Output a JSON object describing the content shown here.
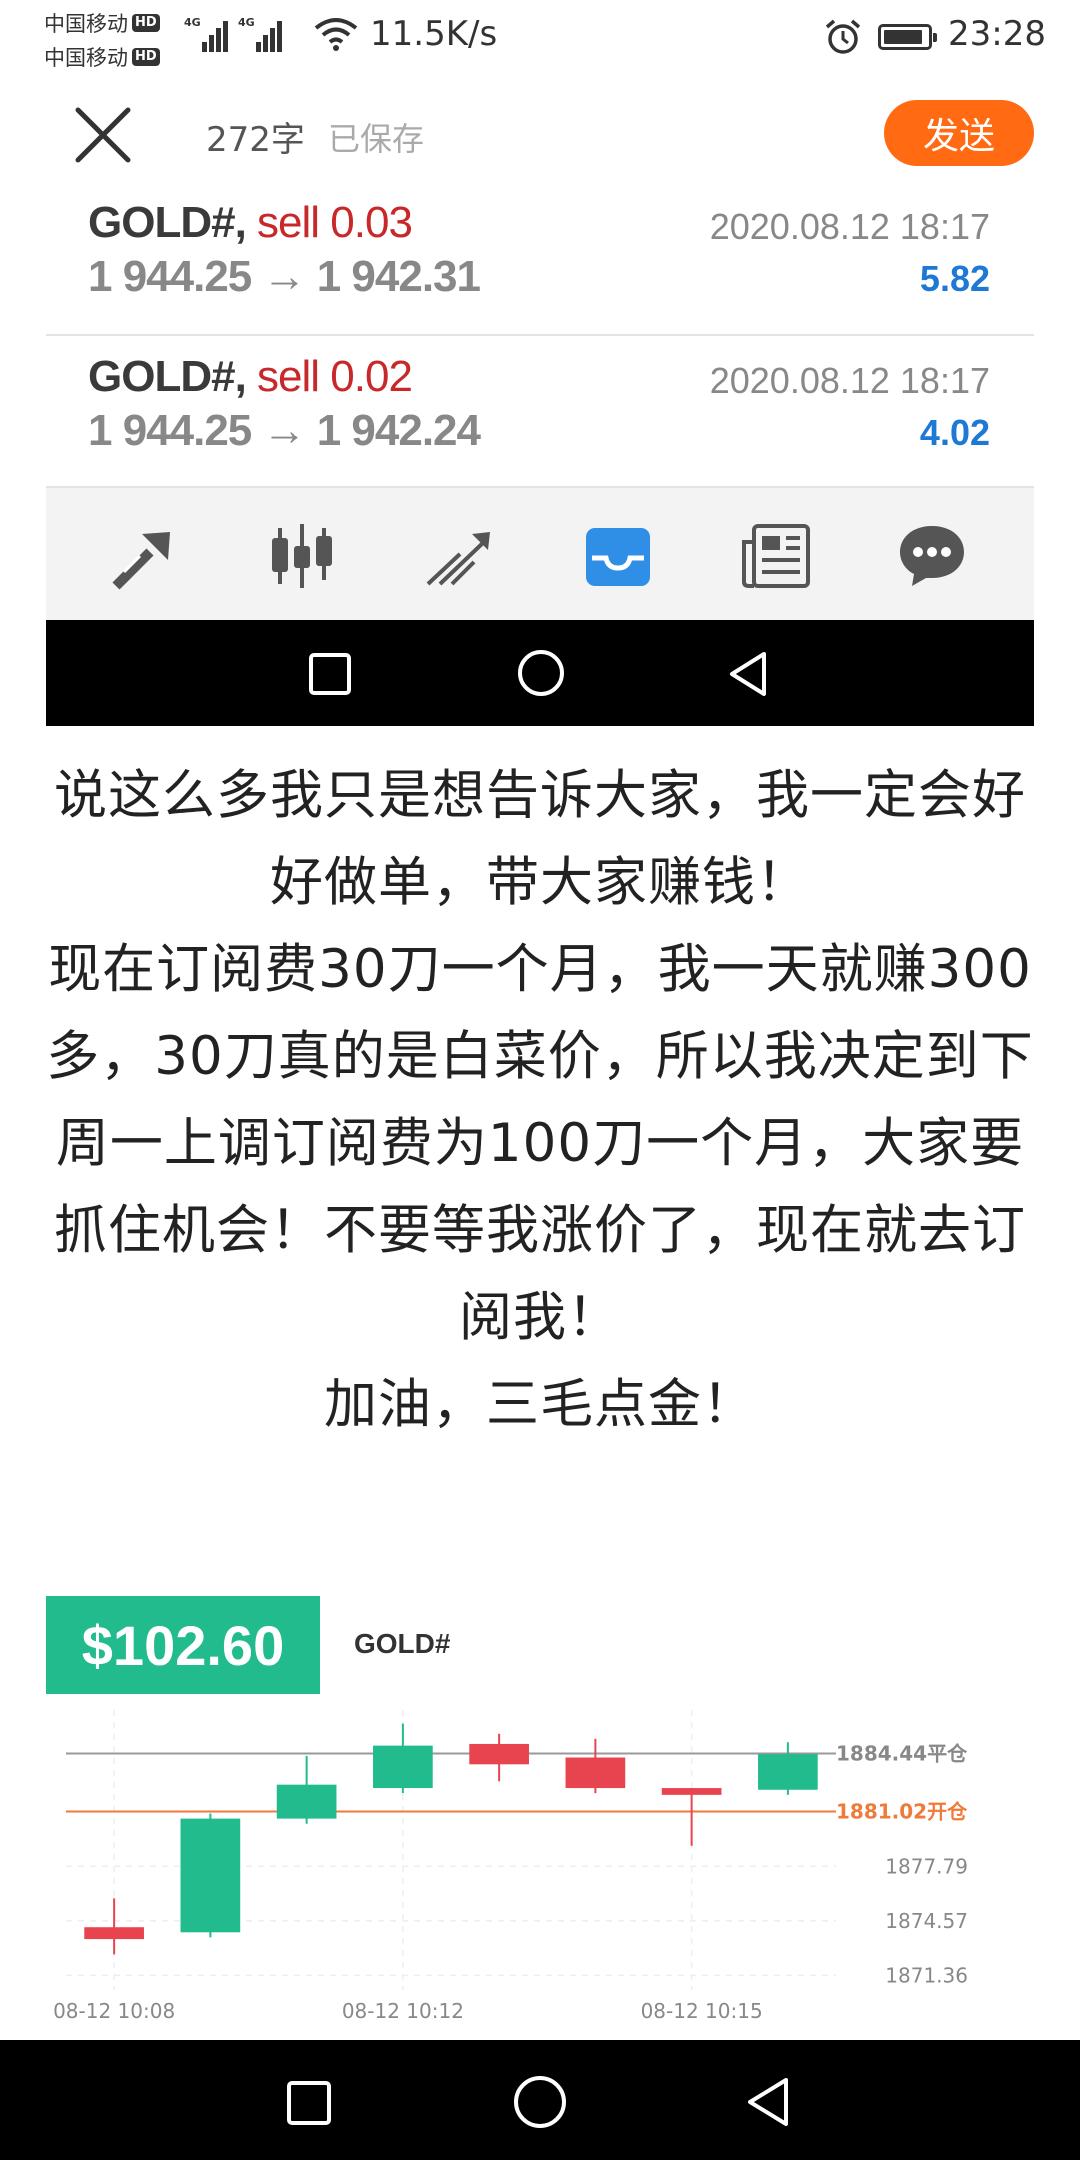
{
  "status_bar": {
    "carrier1": "中国移动",
    "carrier2": "中国移动",
    "hd_badge": "HD",
    "network_tag": "4G",
    "net_speed": "11.5K/s",
    "time": "23:28"
  },
  "editor": {
    "word_count": "272字",
    "saved_status": "已保存",
    "send_label": "发送",
    "accent_color": "#ff6a13"
  },
  "trades": [
    {
      "symbol": "GOLD#,",
      "side": "sell 0.03",
      "prices": "1 944.25 → 1 942.31",
      "time": "2020.08.12 18:17",
      "profit": "5.82"
    },
    {
      "symbol": "GOLD#,",
      "side": "sell 0.02",
      "prices": "1 944.25 → 1 942.24",
      "time": "2020.08.12 18:17",
      "profit": "4.02"
    }
  ],
  "toolbar_icons": [
    "trade-arrow-icon",
    "candlestick-icon",
    "history-chart-icon",
    "inbox-icon",
    "news-icon",
    "chat-icon"
  ],
  "toolbar_active": "inbox-icon",
  "article": {
    "paragraphs": [
      "说这么多我只是想告诉大家，我一定会好好做单，带大家赚钱！",
      "现在订阅费30刀一个月，我一天就赚300多，30刀真的是白菜价，所以我决定到下周一上调订阅费为100刀一个月，大家要抓住机会！不要等我涨价了，现在就去订阅我！",
      "加油，三毛点金！"
    ]
  },
  "signal_card": {
    "profit": "$102.60",
    "symbol": "GOLD#",
    "badge_color": "#22bb8e"
  },
  "chart_data": {
    "type": "candlestick",
    "x_labels": [
      "08-12 10:08",
      "08-12 10:12",
      "08-12 10:15"
    ],
    "y_ticks": [
      "1877.79",
      "1874.57",
      "1871.36"
    ],
    "y_tick_values": [
      1877.79,
      1874.57,
      1871.36
    ],
    "close_line": {
      "value": 1884.44,
      "label": "1884.44平仓",
      "color": "#999999"
    },
    "open_line": {
      "value": 1881.02,
      "label": "1881.02开仓",
      "color": "#f07a3a"
    },
    "candles": [
      {
        "open": 1874.2,
        "close": 1873.5,
        "high": 1875.9,
        "low": 1872.6
      },
      {
        "open": 1873.9,
        "close": 1880.6,
        "high": 1880.9,
        "low": 1873.6
      },
      {
        "open": 1880.6,
        "close": 1882.6,
        "high": 1884.3,
        "low": 1880.3
      },
      {
        "open": 1882.4,
        "close": 1884.9,
        "high": 1886.2,
        "low": 1882.1
      },
      {
        "open": 1885.0,
        "close": 1883.8,
        "high": 1885.6,
        "low": 1882.8
      },
      {
        "open": 1884.2,
        "close": 1882.4,
        "high": 1885.3,
        "low": 1882.1
      },
      {
        "open": 1882.4,
        "close": 1882.0,
        "high": 1882.4,
        "low": 1879.0
      },
      {
        "open": 1882.3,
        "close": 1884.4,
        "high": 1885.1,
        "low": 1882.0
      }
    ],
    "up_color": "#22bb8e",
    "down_color": "#e8444f",
    "ylim": [
      1870.5,
      1887.0
    ]
  }
}
